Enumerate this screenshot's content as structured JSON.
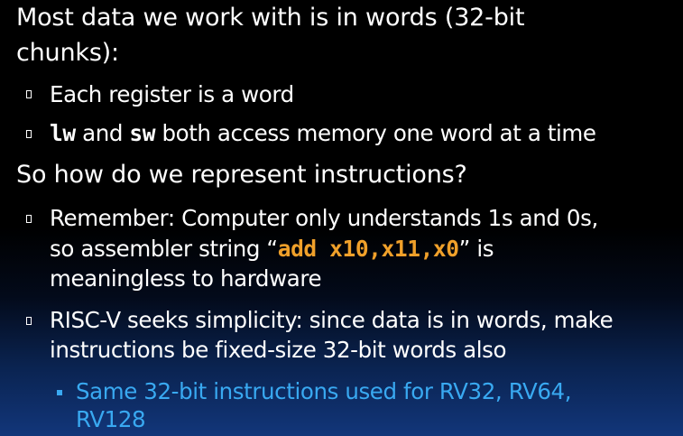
{
  "colors": {
    "text": "#ffffff",
    "code_highlight": "#f0a02a",
    "sub_bullet": "#39a9f1"
  },
  "heading1": {
    "line1": "Most data we work with is in words (32-bit",
    "line2": "chunks):"
  },
  "bullet1": "Each register is a word",
  "bullet2": {
    "code_a": "lw",
    "mid": " and ",
    "code_b": "sw",
    "rest": " both access memory one word at a time"
  },
  "heading2": "So how do we represent instructions?",
  "bullet3": {
    "line1": "Remember: Computer only understands 1s and 0s,",
    "line2_pre": "so assembler string “",
    "line2_code": "add x10,x11,x0",
    "line2_post": "” is",
    "line3": "meaningless to hardware"
  },
  "bullet4": {
    "line1": "RISC-V seeks simplicity: since data is in words, make",
    "line2": "instructions be fixed-size 32-bit words also"
  },
  "sub_bullet": {
    "line1": "Same 32-bit instructions used for RV32, RV64,",
    "line2": "RV128"
  }
}
